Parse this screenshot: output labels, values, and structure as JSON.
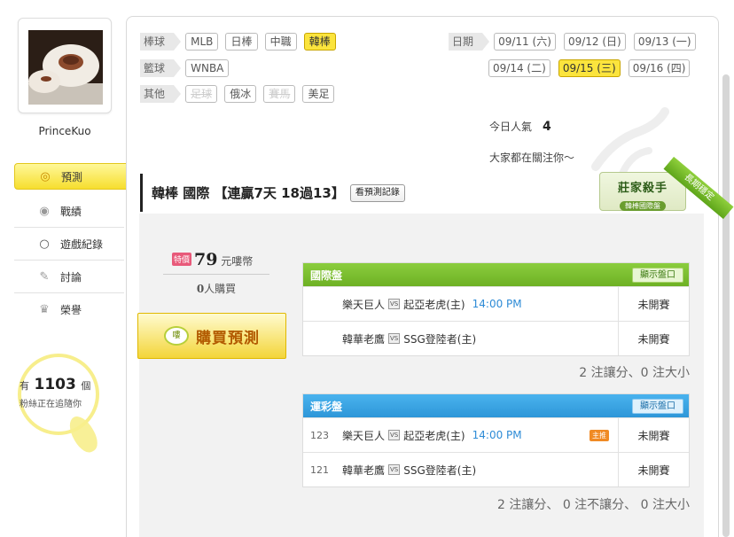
{
  "user": {
    "name": "PrinceKuo"
  },
  "side_menu": [
    {
      "label": "預測",
      "icon": "target-icon",
      "active": true
    },
    {
      "label": "戰績",
      "icon": "trophy-icon"
    },
    {
      "label": "遊戲紀錄",
      "icon": "ring-icon"
    },
    {
      "label": "討論",
      "icon": "chat-icon"
    },
    {
      "label": "榮譽",
      "icon": "medal-icon"
    }
  ],
  "fans": {
    "prefix": "有",
    "count": "1103",
    "unit": "個",
    "sub": "粉絲正在追隨你"
  },
  "filters": {
    "baseball": {
      "label": "棒球",
      "items": [
        "MLB",
        "日棒",
        "中職",
        "韓棒"
      ],
      "active": "韓棒"
    },
    "basketball": {
      "label": "籃球",
      "items": [
        "WNBA"
      ]
    },
    "other": {
      "label": "其他",
      "items": [
        "足球",
        "俄冰",
        "賽馬",
        "美足"
      ],
      "disabled": [
        "足球",
        "賽馬"
      ]
    }
  },
  "dates": {
    "label": "日期",
    "row1": [
      "09/11 (六)",
      "09/12 (日)",
      "09/13 (一)"
    ],
    "row2": [
      "09/14 (二)",
      "09/15 (三)",
      "09/16 (四)"
    ],
    "active": "09/15 (三)"
  },
  "stats": {
    "popularity_label": "今日人氣",
    "popularity_value": "4",
    "attention_text": "大家都在關注你～"
  },
  "header": {
    "title": "韓棒 國際 【連贏7天 18過13】",
    "history_btn": "看預測記錄"
  },
  "badge": {
    "title": "莊家殺手",
    "sub": "韓棒國際盤",
    "ribbon": "長期穩定"
  },
  "purchase": {
    "badge": "特價",
    "price": "79",
    "currency": "元嘍幣",
    "buyers_count": "0",
    "buyers_label": "人購買",
    "button": "購買預測",
    "coin": "嘍"
  },
  "intl_table": {
    "title": "國際盤",
    "show_btn": "顯示盤口",
    "rows": [
      {
        "home": "樂天巨人",
        "away": "起亞老虎(主)",
        "time": "14:00 PM",
        "status": "未開賽"
      },
      {
        "home": "韓華老鷹",
        "away": "SSG登陸者(主)",
        "time": "",
        "status": "未開賽"
      }
    ],
    "summary": "2 注讓分、0 注大小"
  },
  "lottery_table": {
    "title": "運彩盤",
    "show_btn": "顯示盤口",
    "rows": [
      {
        "no": "123",
        "home": "樂天巨人",
        "away": "起亞老虎(主)",
        "time": "14:00 PM",
        "tag": "主推",
        "status": "未開賽"
      },
      {
        "no": "121",
        "home": "韓華老鷹",
        "away": "SSG登陸者(主)",
        "time": "",
        "tag": "",
        "status": "未開賽"
      }
    ],
    "summary": "2 注讓分、 0 注不讓分、 0 注大小"
  },
  "vs_label": "VS"
}
